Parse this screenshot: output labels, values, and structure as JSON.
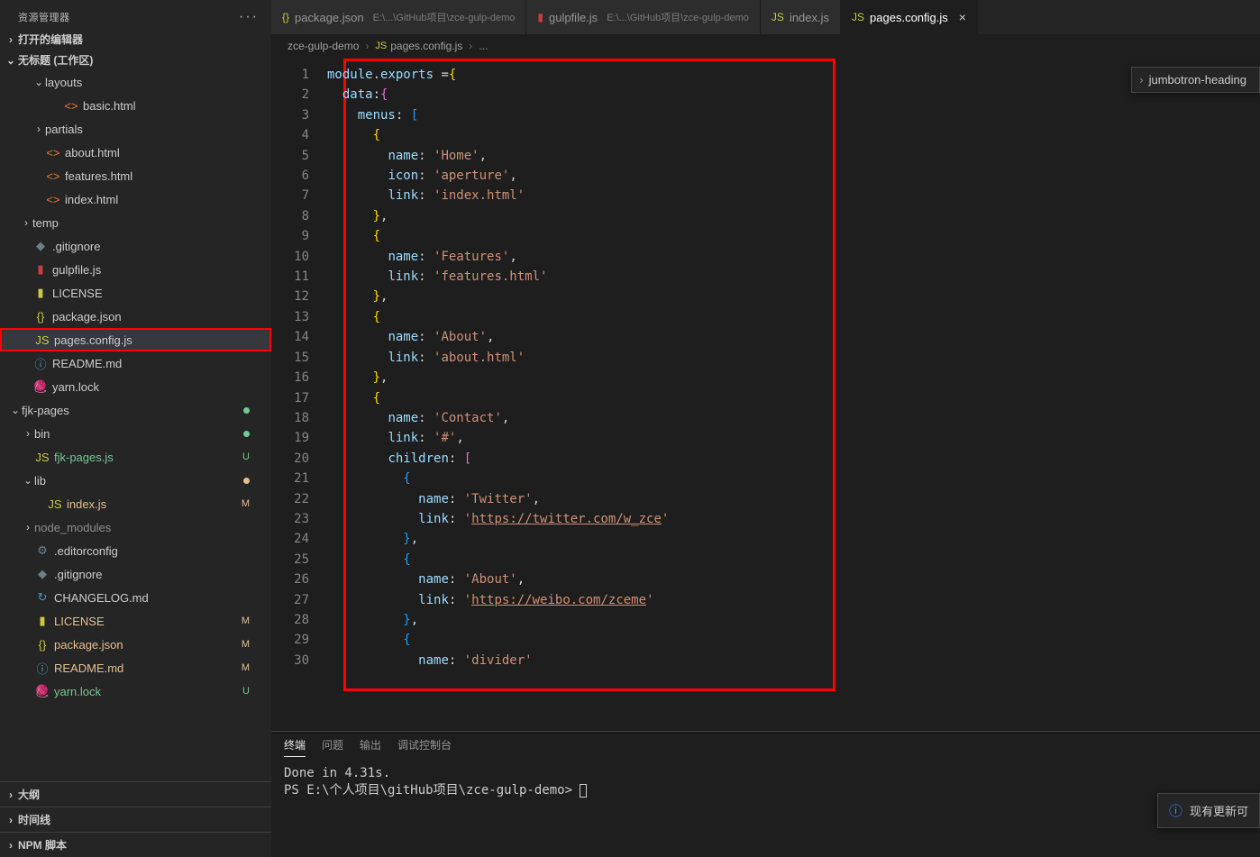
{
  "sidebar": {
    "title": "资源管理器",
    "open_editors": "打开的编辑器",
    "workspace": "无标题 (工作区)",
    "items": [
      {
        "indent": 36,
        "chev": "⌄",
        "icon": "",
        "label": "layouts"
      },
      {
        "indent": 56,
        "chev": "",
        "icon": "<>",
        "iconClass": "ic-orange",
        "label": "basic.html"
      },
      {
        "indent": 36,
        "chev": "›",
        "icon": "",
        "label": "partials"
      },
      {
        "indent": 36,
        "chev": "",
        "icon": "<>",
        "iconClass": "ic-orange",
        "label": "about.html"
      },
      {
        "indent": 36,
        "chev": "",
        "icon": "<>",
        "iconClass": "ic-orange",
        "label": "features.html"
      },
      {
        "indent": 36,
        "chev": "",
        "icon": "<>",
        "iconClass": "ic-orange",
        "label": "index.html"
      },
      {
        "indent": 22,
        "chev": "›",
        "icon": "",
        "label": "temp"
      },
      {
        "indent": 22,
        "chev": "",
        "icon": "◆",
        "iconClass": "ic-gray",
        "label": ".gitignore"
      },
      {
        "indent": 22,
        "chev": "",
        "icon": "▮",
        "iconClass": "ic-red",
        "label": "gulpfile.js"
      },
      {
        "indent": 22,
        "chev": "",
        "icon": "▮",
        "iconClass": "ic-yellow",
        "label": "LICENSE"
      },
      {
        "indent": 22,
        "chev": "",
        "icon": "{}",
        "iconClass": "ic-yellow",
        "label": "package.json"
      },
      {
        "indent": 22,
        "chev": "",
        "icon": "JS",
        "iconClass": "ic-yellow",
        "label": "pages.config.js",
        "selected": true,
        "boxed": true
      },
      {
        "indent": 22,
        "chev": "",
        "icon": "ⓘ",
        "iconClass": "ic-blue",
        "label": "README.md"
      },
      {
        "indent": 22,
        "chev": "",
        "icon": "🧶",
        "iconClass": "ic-purple",
        "label": "yarn.lock"
      },
      {
        "indent": 10,
        "chev": "⌄",
        "icon": "",
        "label": "fjk-pages",
        "dot": "dot-u"
      },
      {
        "indent": 24,
        "chev": "›",
        "icon": "",
        "label": "bin",
        "dot": "dot-u"
      },
      {
        "indent": 24,
        "chev": "",
        "icon": "JS",
        "iconClass": "ic-yellow",
        "label": "fjk-pages.js",
        "status": "U",
        "statusClass": "status-u"
      },
      {
        "indent": 24,
        "chev": "⌄",
        "icon": "",
        "label": "lib",
        "dot": "dot-m"
      },
      {
        "indent": 38,
        "chev": "",
        "icon": "JS",
        "iconClass": "ic-yellow",
        "label": "index.js",
        "status": "M",
        "statusClass": "status-m"
      },
      {
        "indent": 24,
        "chev": "›",
        "icon": "",
        "label": "node_modules",
        "gray": true
      },
      {
        "indent": 24,
        "chev": "",
        "icon": "⚙",
        "iconClass": "ic-gray",
        "label": ".editorconfig"
      },
      {
        "indent": 24,
        "chev": "",
        "icon": "◆",
        "iconClass": "ic-gray",
        "label": ".gitignore"
      },
      {
        "indent": 24,
        "chev": "",
        "icon": "↻",
        "iconClass": "ic-blue",
        "label": "CHANGELOG.md"
      },
      {
        "indent": 24,
        "chev": "",
        "icon": "▮",
        "iconClass": "ic-yellow",
        "label": "LICENSE",
        "status": "M",
        "statusClass": "status-m"
      },
      {
        "indent": 24,
        "chev": "",
        "icon": "{}",
        "iconClass": "ic-yellow",
        "label": "package.json",
        "status": "M",
        "statusClass": "status-m"
      },
      {
        "indent": 24,
        "chev": "",
        "icon": "ⓘ",
        "iconClass": "ic-blue",
        "label": "README.md",
        "status": "M",
        "statusClass": "status-m"
      },
      {
        "indent": 24,
        "chev": "",
        "icon": "🧶",
        "iconClass": "ic-purple",
        "label": "yarn.lock",
        "status": "U",
        "statusClass": "status-u"
      }
    ],
    "bottom": [
      "大纲",
      "时间线",
      "NPM 脚本"
    ]
  },
  "tabs": [
    {
      "icon": "{}",
      "iconClass": "ic-yellow",
      "label": "package.json",
      "path": "E:\\...\\GitHub项目\\zce-gulp-demo"
    },
    {
      "icon": "▮",
      "iconClass": "ic-red",
      "label": "gulpfile.js",
      "path": "E:\\...\\GitHub项目\\zce-gulp-demo"
    },
    {
      "icon": "JS",
      "iconClass": "ic-yellow",
      "label": "index.js"
    },
    {
      "icon": "JS",
      "iconClass": "ic-yellow",
      "label": "pages.config.js",
      "active": true,
      "close": true
    }
  ],
  "breadcrumb": [
    "zce-gulp-demo",
    "pages.config.js",
    "..."
  ],
  "breadcrumb_icon": "JS",
  "outline_popup": "jumbotron-heading",
  "code_lines": [
    [
      {
        "t": "module",
        "c": "var"
      },
      {
        "t": ".",
        "c": "punc"
      },
      {
        "t": "exports",
        "c": "var"
      },
      {
        "t": " ",
        "c": "punc"
      },
      {
        "t": "=",
        "c": "punc"
      },
      {
        "t": "{",
        "c": "bracket0"
      }
    ],
    [
      {
        "t": "  ",
        "c": "punc"
      },
      {
        "t": "data",
        "c": "prop"
      },
      {
        "t": ":",
        "c": "punc"
      },
      {
        "t": "{",
        "c": "bracket1"
      }
    ],
    [
      {
        "t": "    ",
        "c": "punc"
      },
      {
        "t": "menus",
        "c": "prop"
      },
      {
        "t": ": ",
        "c": "punc"
      },
      {
        "t": "[",
        "c": "bracket2"
      }
    ],
    [
      {
        "t": "      ",
        "c": "punc"
      },
      {
        "t": "{",
        "c": "bracket0"
      }
    ],
    [
      {
        "t": "        ",
        "c": "punc"
      },
      {
        "t": "name",
        "c": "prop"
      },
      {
        "t": ": ",
        "c": "punc"
      },
      {
        "t": "'Home'",
        "c": "str"
      },
      {
        "t": ",",
        "c": "punc"
      }
    ],
    [
      {
        "t": "        ",
        "c": "punc"
      },
      {
        "t": "icon",
        "c": "prop"
      },
      {
        "t": ": ",
        "c": "punc"
      },
      {
        "t": "'aperture'",
        "c": "str"
      },
      {
        "t": ",",
        "c": "punc"
      }
    ],
    [
      {
        "t": "        ",
        "c": "punc"
      },
      {
        "t": "link",
        "c": "prop"
      },
      {
        "t": ": ",
        "c": "punc"
      },
      {
        "t": "'index.html'",
        "c": "str"
      }
    ],
    [
      {
        "t": "      ",
        "c": "punc"
      },
      {
        "t": "}",
        "c": "bracket0"
      },
      {
        "t": ",",
        "c": "punc"
      }
    ],
    [
      {
        "t": "      ",
        "c": "punc"
      },
      {
        "t": "{",
        "c": "bracket0"
      }
    ],
    [
      {
        "t": "        ",
        "c": "punc"
      },
      {
        "t": "name",
        "c": "prop"
      },
      {
        "t": ": ",
        "c": "punc"
      },
      {
        "t": "'Features'",
        "c": "str"
      },
      {
        "t": ",",
        "c": "punc"
      }
    ],
    [
      {
        "t": "        ",
        "c": "punc"
      },
      {
        "t": "link",
        "c": "prop"
      },
      {
        "t": ": ",
        "c": "punc"
      },
      {
        "t": "'features.html'",
        "c": "str"
      }
    ],
    [
      {
        "t": "      ",
        "c": "punc"
      },
      {
        "t": "}",
        "c": "bracket0"
      },
      {
        "t": ",",
        "c": "punc"
      }
    ],
    [
      {
        "t": "      ",
        "c": "punc"
      },
      {
        "t": "{",
        "c": "bracket0"
      }
    ],
    [
      {
        "t": "        ",
        "c": "punc"
      },
      {
        "t": "name",
        "c": "prop"
      },
      {
        "t": ": ",
        "c": "punc"
      },
      {
        "t": "'About'",
        "c": "str"
      },
      {
        "t": ",",
        "c": "punc"
      }
    ],
    [
      {
        "t": "        ",
        "c": "punc"
      },
      {
        "t": "link",
        "c": "prop"
      },
      {
        "t": ": ",
        "c": "punc"
      },
      {
        "t": "'about.html'",
        "c": "str"
      }
    ],
    [
      {
        "t": "      ",
        "c": "punc"
      },
      {
        "t": "}",
        "c": "bracket0"
      },
      {
        "t": ",",
        "c": "punc"
      }
    ],
    [
      {
        "t": "      ",
        "c": "punc"
      },
      {
        "t": "{",
        "c": "bracket0"
      }
    ],
    [
      {
        "t": "        ",
        "c": "punc"
      },
      {
        "t": "name",
        "c": "prop"
      },
      {
        "t": ": ",
        "c": "punc"
      },
      {
        "t": "'Contact'",
        "c": "str"
      },
      {
        "t": ",",
        "c": "punc"
      }
    ],
    [
      {
        "t": "        ",
        "c": "punc"
      },
      {
        "t": "link",
        "c": "prop"
      },
      {
        "t": ": ",
        "c": "punc"
      },
      {
        "t": "'#'",
        "c": "str"
      },
      {
        "t": ",",
        "c": "punc"
      }
    ],
    [
      {
        "t": "        ",
        "c": "punc"
      },
      {
        "t": "children",
        "c": "prop"
      },
      {
        "t": ": ",
        "c": "punc"
      },
      {
        "t": "[",
        "c": "bracket1"
      }
    ],
    [
      {
        "t": "          ",
        "c": "punc"
      },
      {
        "t": "{",
        "c": "bracket2"
      }
    ],
    [
      {
        "t": "            ",
        "c": "punc"
      },
      {
        "t": "name",
        "c": "prop"
      },
      {
        "t": ": ",
        "c": "punc"
      },
      {
        "t": "'Twitter'",
        "c": "str"
      },
      {
        "t": ",",
        "c": "punc"
      }
    ],
    [
      {
        "t": "            ",
        "c": "punc"
      },
      {
        "t": "link",
        "c": "prop"
      },
      {
        "t": ": ",
        "c": "punc"
      },
      {
        "t": "'",
        "c": "str"
      },
      {
        "t": "https://twitter.com/w_zce",
        "c": "link"
      },
      {
        "t": "'",
        "c": "str"
      }
    ],
    [
      {
        "t": "          ",
        "c": "punc"
      },
      {
        "t": "}",
        "c": "bracket2"
      },
      {
        "t": ",",
        "c": "punc"
      }
    ],
    [
      {
        "t": "          ",
        "c": "punc"
      },
      {
        "t": "{",
        "c": "bracket2"
      }
    ],
    [
      {
        "t": "            ",
        "c": "punc"
      },
      {
        "t": "name",
        "c": "prop"
      },
      {
        "t": ": ",
        "c": "punc"
      },
      {
        "t": "'About'",
        "c": "str"
      },
      {
        "t": ",",
        "c": "punc"
      }
    ],
    [
      {
        "t": "            ",
        "c": "punc"
      },
      {
        "t": "link",
        "c": "prop"
      },
      {
        "t": ": ",
        "c": "punc"
      },
      {
        "t": "'",
        "c": "str"
      },
      {
        "t": "https://weibo.com/zceme",
        "c": "link"
      },
      {
        "t": "'",
        "c": "str"
      }
    ],
    [
      {
        "t": "          ",
        "c": "punc"
      },
      {
        "t": "}",
        "c": "bracket2"
      },
      {
        "t": ",",
        "c": "punc"
      }
    ],
    [
      {
        "t": "          ",
        "c": "punc"
      },
      {
        "t": "{",
        "c": "bracket2"
      }
    ],
    [
      {
        "t": "            ",
        "c": "punc"
      },
      {
        "t": "name",
        "c": "prop"
      },
      {
        "t": ": ",
        "c": "punc"
      },
      {
        "t": "'divider'",
        "c": "str"
      }
    ]
  ],
  "terminal": {
    "tabs": [
      "终端",
      "问题",
      "输出",
      "调试控制台"
    ],
    "lines": [
      "Done in 4.31s.",
      "PS E:\\个人项目\\gitHub项目\\zce-gulp-demo> "
    ]
  },
  "notification": "现有更新可"
}
